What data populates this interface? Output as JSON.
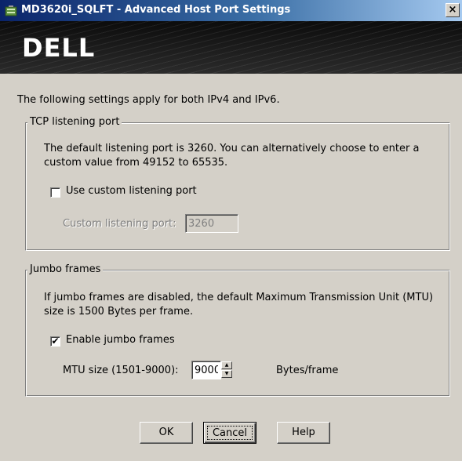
{
  "window": {
    "title": "MD3620i_SQLFT - Advanced Host Port Settings",
    "close_symbol": "×",
    "icon": "storage-array-icon"
  },
  "banner": {
    "logo_text": "DELL"
  },
  "intro_text": "The following settings apply for both IPv4 and IPv6.",
  "tcp": {
    "legend": "TCP listening port",
    "description": "The default listening port is 3260. You can alternatively choose to enter a custom value from 49152 to 65535.",
    "use_custom_label": "Use custom listening port",
    "use_custom_checked": false,
    "custom_port_label": "Custom listening port:",
    "custom_port_value": "3260"
  },
  "jumbo": {
    "legend": "Jumbo frames",
    "description": "If jumbo frames are disabled, the default Maximum Transmission Unit (MTU) size is 1500 Bytes per frame.",
    "enable_label": "Enable jumbo frames",
    "enable_checked": true,
    "check_mark": "✔",
    "mtu_label": "MTU size (1501-9000):",
    "mtu_value": "9000",
    "unit_label": "Bytes/frame"
  },
  "buttons": {
    "ok": "OK",
    "cancel": "Cancel",
    "help": "Help"
  },
  "colors": {
    "dialog_bg": "#d4d0c8",
    "title_bar": "#0a246a",
    "banner_bg": "#1a1a1a"
  }
}
